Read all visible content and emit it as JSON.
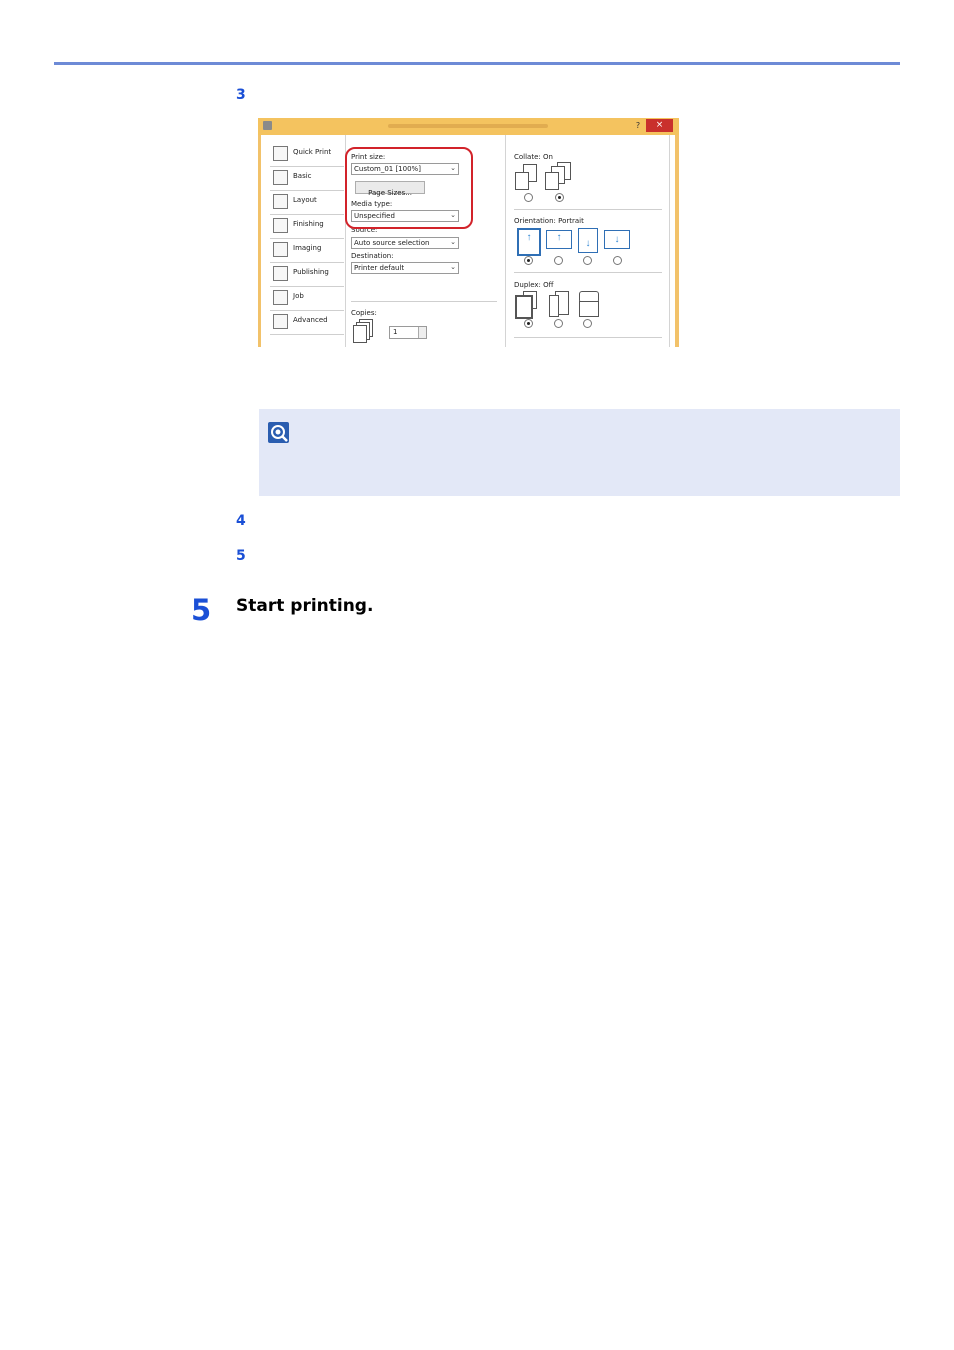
{
  "steps": {
    "sub3": "3",
    "sub4": "4",
    "sub5": "5",
    "main5_num": "5",
    "main5_text": "Start printing."
  },
  "dialog": {
    "help": "?",
    "close": "×",
    "nav": [
      {
        "label": "Quick Print",
        "icon": "quick-print-icon"
      },
      {
        "label": "Basic",
        "icon": "basic-icon"
      },
      {
        "label": "Layout",
        "icon": "layout-icon"
      },
      {
        "label": "Finishing",
        "icon": "finishing-icon"
      },
      {
        "label": "Imaging",
        "icon": "imaging-icon"
      },
      {
        "label": "Publishing",
        "icon": "publishing-icon"
      },
      {
        "label": "Job",
        "icon": "job-icon"
      },
      {
        "label": "Advanced",
        "icon": "advanced-icon"
      }
    ],
    "print_size_label": "Print size:",
    "print_size_value": "Custom_01 [100%]",
    "page_sizes_button": "Page Sizes...",
    "media_type_label": "Media type:",
    "media_type_value": "Unspecified",
    "source_label": "Source:",
    "source_value": "Auto source selection",
    "destination_label": "Destination:",
    "destination_value": "Printer default",
    "copies_label": "Copies:",
    "copies_value": "1",
    "collate_label": "Collate:  On",
    "orientation_label": "Orientation:  Portrait",
    "duplex_label": "Duplex:  Off",
    "highlight_color": "#d2232a",
    "accent_color": "#2f86d4"
  }
}
